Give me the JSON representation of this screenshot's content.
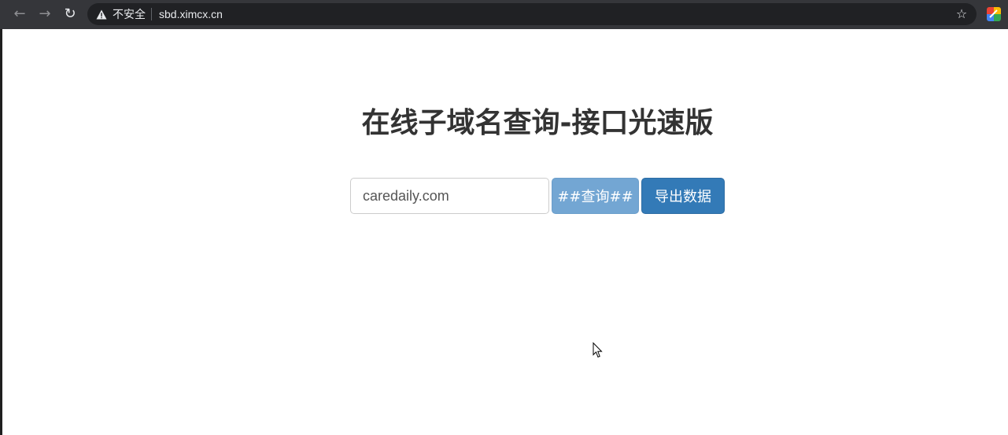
{
  "browser": {
    "nav": {
      "back_glyph": "←",
      "forward_glyph": "→",
      "reload_glyph": "↻"
    },
    "security_label": "不安全",
    "url": "sbd.ximcx.cn",
    "star_glyph": "☆"
  },
  "page": {
    "title": "在线子域名查询-接口光速版",
    "search": {
      "value": "caredaily.com"
    },
    "query_button_label": "##查询##",
    "export_button_label": "导出数据"
  },
  "colors": {
    "query_button": "#73a6d3",
    "export_button": "#337ab7",
    "title_text": "#333333",
    "browser_bar": "#35363a",
    "omnibox": "#202124"
  }
}
